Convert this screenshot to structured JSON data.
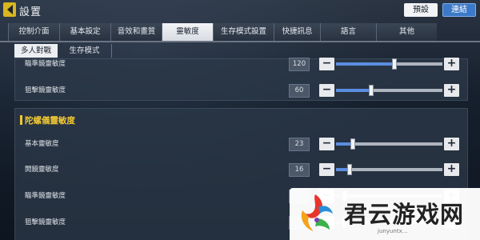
{
  "header": {
    "title": "設置",
    "preset_label": "預設",
    "connect_label": "連結"
  },
  "tabs": [
    {
      "label": "控制介面",
      "active": false
    },
    {
      "label": "基本設定",
      "active": false
    },
    {
      "label": "音效和畫質",
      "active": false
    },
    {
      "label": "靈敏度",
      "active": true
    },
    {
      "label": "生存模式設置",
      "active": false
    },
    {
      "label": "快捷訊息",
      "active": false
    },
    {
      "label": "語言",
      "active": false
    },
    {
      "label": "其他",
      "active": false
    }
  ],
  "subtabs": [
    {
      "label": "多人對戰",
      "active": true
    },
    {
      "label": "生存模式",
      "active": false
    }
  ],
  "panel_top": {
    "rows": [
      {
        "label": "瞄準鏡靈敏度",
        "value": "120",
        "level": 0.55
      },
      {
        "label": "狙擊鏡靈敏度",
        "value": "60",
        "level": 0.33
      }
    ]
  },
  "gyro_section": {
    "title": "陀螺儀靈敏度",
    "rows": [
      {
        "label": "基本靈敏度",
        "value": "23",
        "level": 0.16
      },
      {
        "label": "開鏡靈敏度",
        "value": "16",
        "level": 0.13
      },
      {
        "label": "瞄準鏡靈敏度",
        "value": "",
        "level": 0.08
      },
      {
        "label": "狙擊鏡靈敏度",
        "value": "",
        "level": 0.08
      }
    ]
  },
  "watermark": {
    "brand": "君云游戏网",
    "domain": "junyuntx..."
  },
  "colors": {
    "accent": "#f0c733",
    "slider_fill": "#5b8de0",
    "connect_button": "#3c79c8"
  }
}
